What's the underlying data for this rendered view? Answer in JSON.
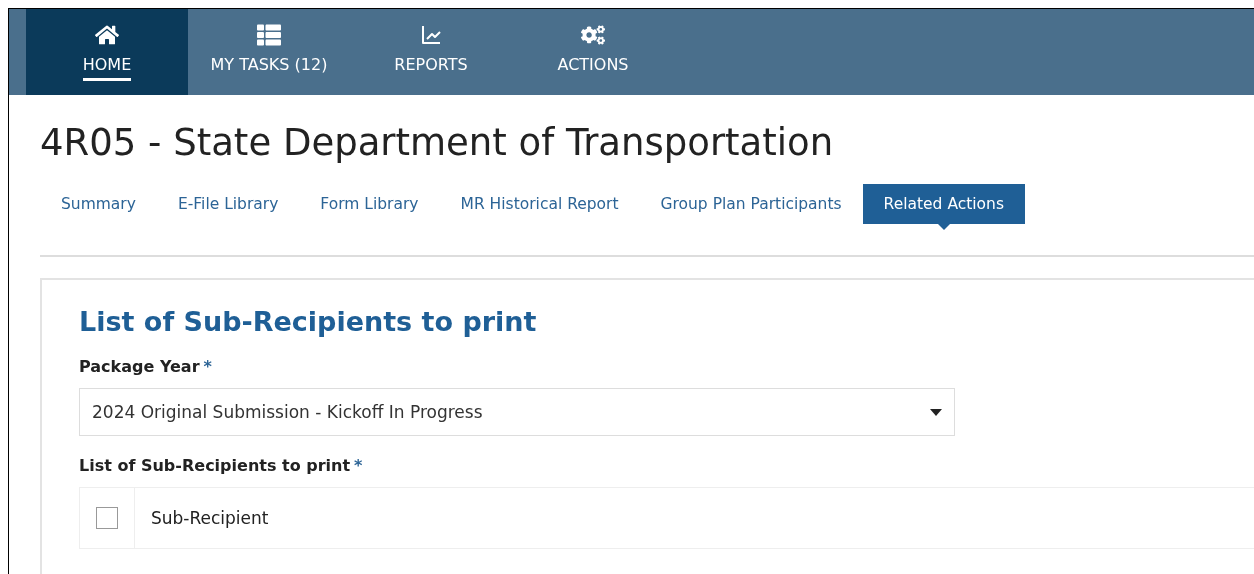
{
  "nav": [
    {
      "kind": "home",
      "label": "HOME",
      "selected": true
    },
    {
      "kind": "tasks",
      "label": "MY TASKS (12)",
      "selected": false
    },
    {
      "kind": "reports",
      "label": "REPORTS",
      "selected": false
    },
    {
      "kind": "actions",
      "label": "ACTIONS",
      "selected": false
    }
  ],
  "page_title": "4R05 - State Department of Transportation",
  "tabs": [
    {
      "label": "Summary",
      "selected": false
    },
    {
      "label": "E-File Library",
      "selected": false
    },
    {
      "label": "Form Library",
      "selected": false
    },
    {
      "label": "MR Historical Report",
      "selected": false
    },
    {
      "label": "Group Plan Participants",
      "selected": false
    },
    {
      "label": "Related Actions",
      "selected": true
    }
  ],
  "form": {
    "heading": "List of Sub-Recipients to print",
    "package_year": {
      "label": "Package Year",
      "required_mark": "*",
      "value": "2024 Original Submission - Kickoff In Progress"
    },
    "list": {
      "label": "List of Sub-Recipients to print",
      "required_mark": "*",
      "select_all_checked": false,
      "columns": [
        "Sub-Recipient"
      ]
    }
  }
}
